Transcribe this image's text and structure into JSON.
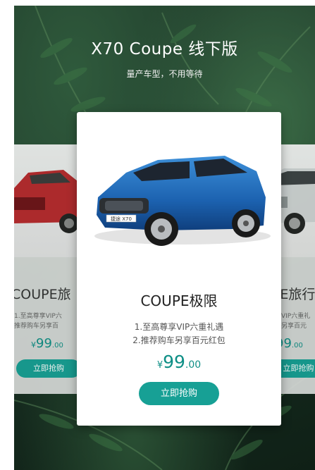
{
  "header": {
    "title": "X70 Coupe 线下版",
    "subtitle": "量产车型，不用等待"
  },
  "main_card": {
    "title": "COUPE极限",
    "benefits": [
      "1.至高尊享VIP六重礼遇",
      "2.推荐购车另享百元红包"
    ],
    "price": {
      "currency": "¥",
      "integer": "99",
      "decimal": ".00"
    },
    "button": "立即抢购",
    "plate": "捷途 X70"
  },
  "left_card": {
    "title": "COUPE旅",
    "benefits": [
      "1.至高尊享VIP六",
      "推荐购车另享百"
    ],
    "price": {
      "currency": "¥",
      "integer": "99",
      "decimal": ".00"
    },
    "button": "立即抢购"
  },
  "right_card": {
    "title": "UPE旅行",
    "benefits": [
      "高尊享VIP六重礼",
      "荐购车另享百元"
    ],
    "price": {
      "currency": "¥",
      "integer": "99",
      "decimal": ".00"
    },
    "button": "立即抢购"
  },
  "colors": {
    "accent": "#17a095",
    "price": "#0f8f86",
    "background": "#1f3a29"
  }
}
